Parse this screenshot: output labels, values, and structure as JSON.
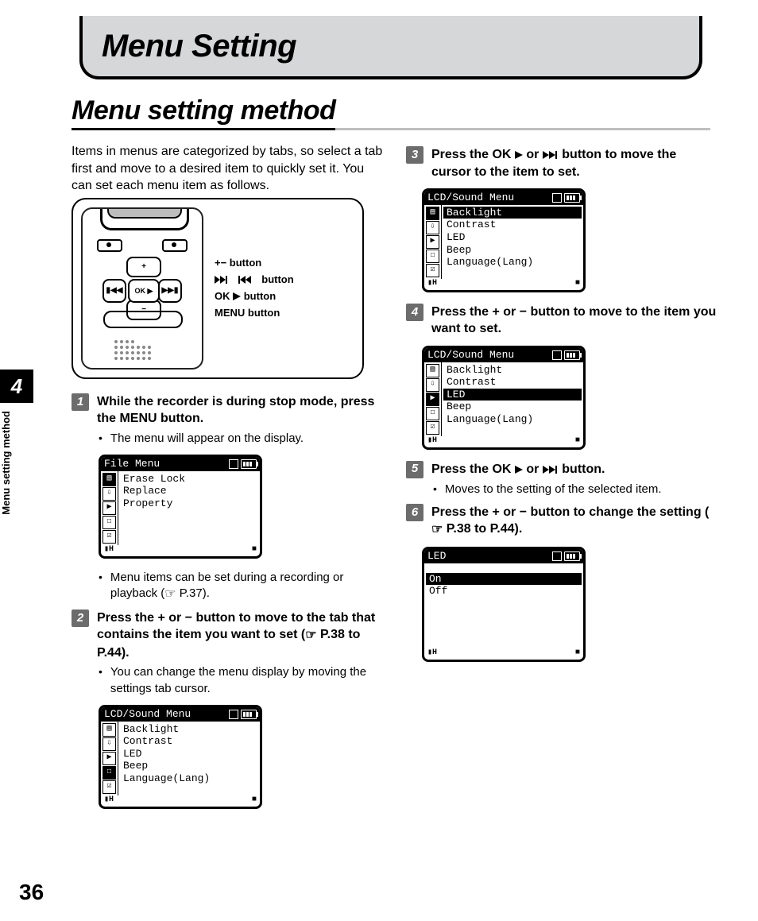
{
  "chapter": {
    "number": "4",
    "side_label": "Menu setting method"
  },
  "page_number": "36",
  "header_title": "Menu Setting",
  "section_title": "Menu setting method",
  "intro": "Items in menus are categorized by tabs, so select a tab first and move to a desired item to quickly set it. You can set each menu item as follows.",
  "device_labels": {
    "l1_a": "+",
    "l1_b": "−",
    "l1_c": " button",
    "l2_c": " button",
    "l3_a": "OK ",
    "l3_c": " button",
    "l4_a": "MENU",
    "l4_c": " button"
  },
  "device_keys": {
    "up": "+",
    "down": "−",
    "left": "▮◀◀",
    "right": "▶▶▮",
    "center": "OK ▶"
  },
  "steps": {
    "s1": {
      "num": "1",
      "text_a": "While the recorder is during stop mode, press the ",
      "btn": "MENU",
      "text_b": " button.",
      "bullet1": "The menu will appear on the display.",
      "bullet2_a": "Menu items can be set during a recording or playback (",
      "bullet2_b": " P.37)."
    },
    "s2": {
      "num": "2",
      "text_a": "Press the ",
      "btn1": "+",
      "mid": " or ",
      "btn2": "−",
      "text_b": " button to move to the tab that contains the item you want to set (",
      "ref": " P.38 to P.44).",
      "bullet1": "You can change the menu display by moving the settings tab cursor."
    },
    "s3": {
      "num": "3",
      "text_a": "Press the ",
      "btn1": "OK ",
      "mid": " or ",
      "text_b": " button to move the cursor to the item to set."
    },
    "s4": {
      "num": "4",
      "text_a": "Press the ",
      "btn1": "+",
      "mid": " or ",
      "btn2": "−",
      "text_b": " button  to move to the item you want to set."
    },
    "s5": {
      "num": "5",
      "text_a": "Press the ",
      "btn1": "OK ",
      "mid": " or ",
      "text_b": " button.",
      "bullet1": "Moves to the setting of the selected item."
    },
    "s6": {
      "num": "6",
      "text_a": "Press the ",
      "btn1": "+",
      "mid": " or ",
      "btn2": "−",
      "text_b": " button to change the setting (",
      "ref": " P.38 to P.44)."
    }
  },
  "lcd_file": {
    "title": "File Menu",
    "items": [
      "Erase Lock",
      "Replace",
      "Property"
    ],
    "tabs_count": 5,
    "selected_tab": 0,
    "selected_row": -1,
    "footer_left": "▮H",
    "footer_right": "■"
  },
  "lcd_sound_beep": {
    "title": "LCD/Sound Menu",
    "items": [
      "Backlight",
      "Contrast",
      "LED",
      "Beep",
      "Language(Lang)"
    ],
    "selected_tab": 3,
    "selected_row": -1,
    "footer_left": "▮H",
    "footer_right": "■"
  },
  "lcd_sound_backlight": {
    "title": "LCD/Sound Menu",
    "items": [
      "Backlight",
      "Contrast",
      "LED",
      "Beep",
      "Language(Lang)"
    ],
    "selected_tab": 0,
    "selected_row": 0,
    "footer_left": "▮H",
    "footer_right": "■"
  },
  "lcd_sound_led": {
    "title": "LCD/Sound Menu",
    "items": [
      "Backlight",
      "Contrast",
      "LED",
      "Beep",
      "Language(Lang)"
    ],
    "selected_tab": 2,
    "selected_row": 2,
    "footer_left": "▮H",
    "footer_right": "■"
  },
  "lcd_led_setting": {
    "title": "LED",
    "items": [
      "On",
      "Off"
    ],
    "no_tabs": true,
    "selected_row": 0,
    "footer_left": "▮H",
    "footer_right": "■"
  }
}
